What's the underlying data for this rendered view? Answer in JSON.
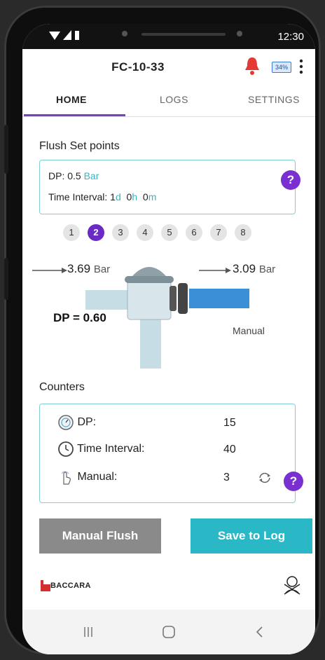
{
  "status": {
    "time": "12:30"
  },
  "app": {
    "title": "FC-10-33",
    "battery": "34%"
  },
  "tabs": [
    {
      "label": "HOME",
      "active": true
    },
    {
      "label": "LOGS",
      "active": false
    },
    {
      "label": "SETTINGS",
      "active": false
    }
  ],
  "flush": {
    "title": "Flush Set points",
    "dp_label": "DP:",
    "dp_value": "0.5",
    "dp_unit": "Bar",
    "interval_label": "Time Interval:",
    "days": "1",
    "days_unit": "d",
    "hours": "0",
    "hours_unit": "h",
    "minutes": "0",
    "minutes_unit": "m",
    "help": "?"
  },
  "pager": {
    "pages": [
      "1",
      "2",
      "3",
      "4",
      "5",
      "6",
      "7",
      "8"
    ],
    "selected": "2"
  },
  "diagram": {
    "inlet_value": "3.69",
    "inlet_unit": "Bar",
    "outlet_value": "3.09",
    "outlet_unit": "Bar",
    "dp": "DP = 0.60",
    "mode": "Manual"
  },
  "counters": {
    "title": "Counters",
    "rows": [
      {
        "icon": "gauge-icon",
        "label": "DP:",
        "value": "15"
      },
      {
        "icon": "clock-icon",
        "label": "Time Interval:",
        "value": "40"
      },
      {
        "icon": "hand-touch-icon",
        "label": "Manual:",
        "value": "3"
      }
    ],
    "help": "?"
  },
  "buttons": {
    "manual_flush": "Manual Flush",
    "save_log": "Save to Log"
  },
  "brand": {
    "name": "BACCARA"
  },
  "colors": {
    "accent": "#7a3fc4",
    "teal": "#2bb8c6",
    "gray_button": "#8a8a8a",
    "alarm": "#e53935"
  }
}
